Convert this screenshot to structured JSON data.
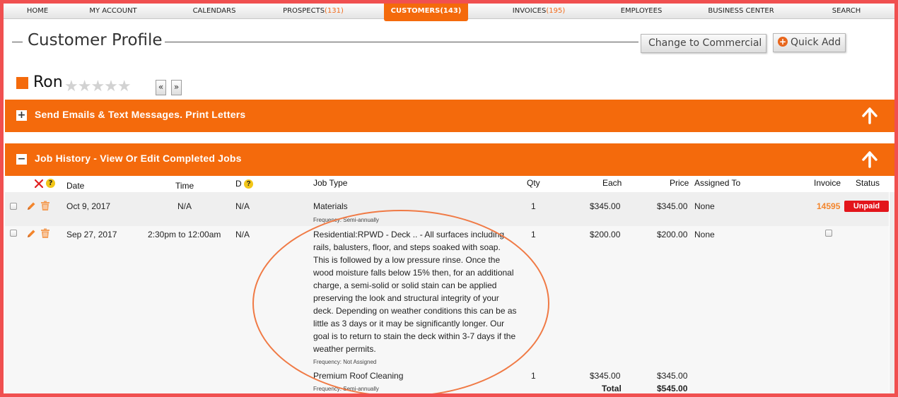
{
  "nav": {
    "home": "HOME",
    "my_account": "MY ACCOUNT",
    "calendars": "CALENDARS",
    "prospects": "PROSPECTS",
    "prospects_count": "(131)",
    "customers": "CUSTOMERS",
    "customers_count": "(143)",
    "invoices": "INVOICES",
    "invoices_count": "(195)",
    "employees": "EMPLOYEES",
    "business_center": "BUSINESS CENTER",
    "search": "SEARCH"
  },
  "header": {
    "title": "Customer Profile",
    "change_commercial": "Change to Commercial",
    "quick_add": "Quick Add"
  },
  "customer": {
    "name": "Ron",
    "stars": "★★★★★",
    "prev": "«",
    "next": "»"
  },
  "sections": {
    "messages": "Send Emails & Text Messages. Print Letters",
    "job_history": "Job History - View Or Edit Completed Jobs",
    "expand": "+",
    "collapse": "−"
  },
  "columns": {
    "date": "Date",
    "time": "Time",
    "d": "D",
    "job_type": "Job Type",
    "qty": "Qty",
    "each": "Each",
    "price": "Price",
    "assigned_to": "Assigned To",
    "invoice": "Invoice",
    "status": "Status",
    "help": "?"
  },
  "jobs": [
    {
      "date": "Oct 9, 2017",
      "time": "N/A",
      "d": "N/A",
      "job_type": "Materials",
      "frequency": "Frequency: Semi-annually",
      "qty": "1",
      "each": "$345.00",
      "price": "$345.00",
      "assigned_to": "None",
      "invoice": "14595",
      "status": "Unpaid"
    },
    {
      "date": "Sep 27, 2017",
      "time": "2:30pm to 12:00am",
      "d": "N/A",
      "job_type": "Residential:RPWD - Deck .. - All surfaces including rails, balusters, floor, and steps soaked with soap. This is followed by a low pressure rinse. Once the wood moisture falls below 15% then, for an additional charge, a semi-solid or solid stain can be applied preserving the look and structural integrity of your deck. Depending on weather conditions this can be as little as 3 days or it may be significantly longer. Our goal is to return to stain the deck within 3-7 days if the weather permits.",
      "frequency": "Frequency: Not Assigned",
      "qty": "1",
      "each": "$200.00",
      "price": "$200.00",
      "assigned_to": "None",
      "sub_job_type": "Premium Roof Cleaning",
      "sub_frequency": "Frequency: Semi-annually",
      "sub_qty": "1",
      "sub_each": "$345.00",
      "sub_price": "$345.00",
      "total_label": "Total",
      "total": "$545.00"
    }
  ],
  "colors": {
    "accent": "#f46a0c",
    "unpaid": "#e3151b",
    "invoice_link": "#f3852c",
    "frame": "#f05050"
  }
}
